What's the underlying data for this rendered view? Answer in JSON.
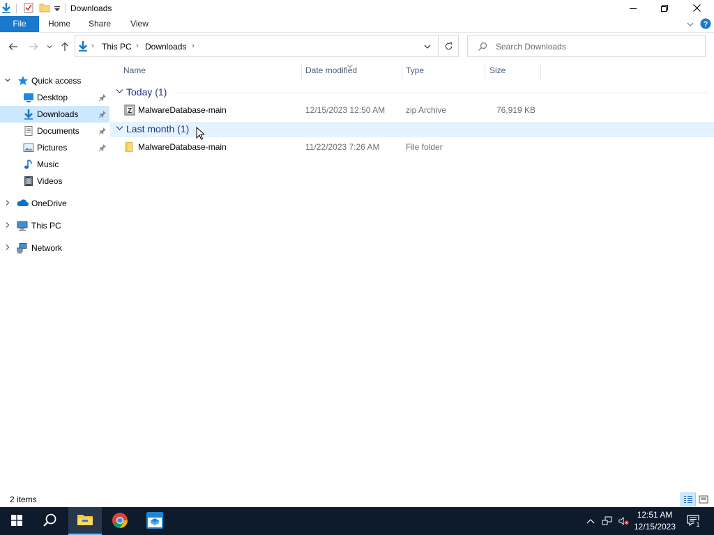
{
  "window": {
    "title": "Downloads",
    "controls": {
      "minimize": "minimize",
      "restore": "restore",
      "close": "close"
    }
  },
  "ribbon": {
    "tabs": [
      "File",
      "Home",
      "Share",
      "View"
    ]
  },
  "address": {
    "crumbs": [
      "This PC",
      "Downloads"
    ],
    "search_placeholder": "Search Downloads"
  },
  "navigation": {
    "quick_access": "Quick access",
    "quick_items": [
      {
        "label": "Desktop",
        "icon": "desktop-icon",
        "pinned": true
      },
      {
        "label": "Downloads",
        "icon": "downloads-icon",
        "pinned": true,
        "selected": true
      },
      {
        "label": "Documents",
        "icon": "documents-icon",
        "pinned": true
      },
      {
        "label": "Pictures",
        "icon": "pictures-icon",
        "pinned": true
      },
      {
        "label": "Music",
        "icon": "music-icon",
        "pinned": false
      },
      {
        "label": "Videos",
        "icon": "videos-icon",
        "pinned": false
      }
    ],
    "roots": [
      {
        "label": "OneDrive",
        "icon": "onedrive-icon"
      },
      {
        "label": "This PC",
        "icon": "this-pc-icon"
      },
      {
        "label": "Network",
        "icon": "network-icon"
      }
    ]
  },
  "columns": {
    "name": "Name",
    "date_modified": "Date modified",
    "type": "Type",
    "size": "Size"
  },
  "groups": [
    {
      "header": "Today (1)",
      "files": [
        {
          "name": "MalwareDatabase-main",
          "date": "12/15/2023 12:50 AM",
          "type": "zip Archive",
          "size": "76,919 KB",
          "icon": "zip-archive-icon"
        }
      ]
    },
    {
      "header": "Last month (1)",
      "hovered": true,
      "files": [
        {
          "name": "MalwareDatabase-main",
          "date": "11/22/2023 7:26 AM",
          "type": "File folder",
          "size": "",
          "icon": "folder-icon"
        }
      ]
    }
  ],
  "status": {
    "item_count": "2 items"
  },
  "taskbar": {
    "apps": [
      "start-icon",
      "search-icon",
      "file-explorer-icon",
      "chrome-icon",
      "sandbox-app-icon"
    ],
    "clock_time": "12:51 AM",
    "clock_date": "12/15/2023",
    "notification_count": "1"
  },
  "colors": {
    "accent": "#1979ca",
    "selection": "#cce8ff",
    "hover_row": "#e5f3ff",
    "group_header": "#1e3287",
    "taskbar": "#0d1b2d"
  }
}
